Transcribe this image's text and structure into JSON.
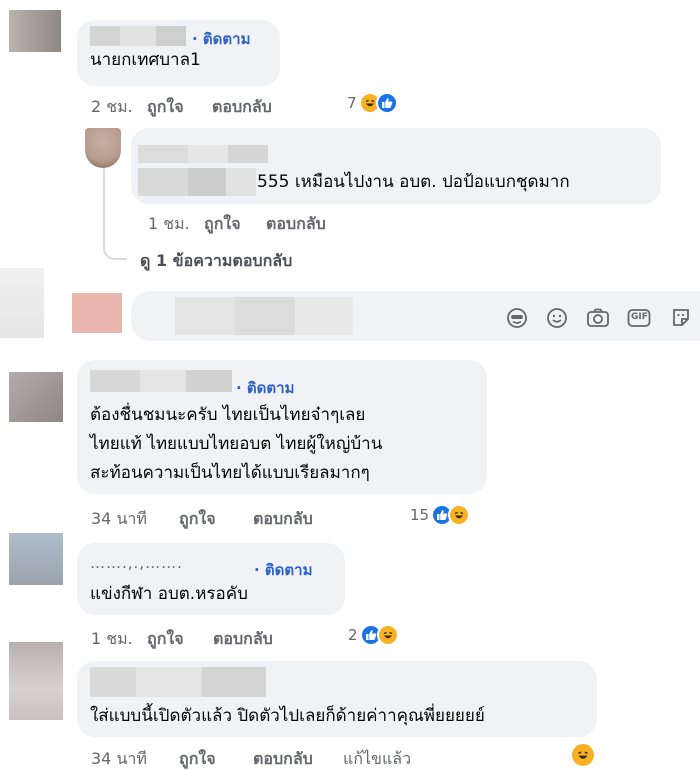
{
  "colors": {
    "bubble": "#f0f2f5",
    "follow": "#2d63c8",
    "meta": "#65676b",
    "like": "#1b74e4",
    "haha": "#f7b125"
  },
  "comments": [
    {
      "follow_label": "· ติดตาม",
      "text_lines": [
        "นายกเทศบาล1"
      ],
      "time": "2 ชม.",
      "like_label": "ถูกใจ",
      "reply_label": "ตอบกลับ",
      "reaction_count": "7",
      "reaction_icons": [
        "haha-icon",
        "like-icon"
      ]
    },
    {
      "text": "555 เหมือนไปงาน อบต. ปอป้อแบกชุดมาก",
      "time": "1 ชม.",
      "like_label": "ถูกใจ",
      "reply_label": "ตอบกลับ",
      "view_replies": "ดู 1 ข้อความตอบกลับ"
    },
    {
      "follow_label": "· ติดตาม",
      "text_lines": [
        "ต้องชื่นชมนะครับ ไทยเป็นไทยจ๋าๆเลย",
        "ไทยแท้ ไทยแบบไทยอบต ไทยผู้ใหญ่บ้าน",
        "สะท้อนความเป็นไทยได้แบบเรียลมากๆ"
      ],
      "time": "34 นาที",
      "like_label": "ถูกใจ",
      "reply_label": "ตอบกลับ",
      "reaction_count": "15",
      "reaction_icons": [
        "like-icon",
        "haha-icon"
      ]
    },
    {
      "name_partial": "…….,.,…….",
      "follow_label": "· ติดตาม",
      "text_lines": [
        "แข่งกีฬา อบต.หรอคับ"
      ],
      "time": "1 ชม.",
      "like_label": "ถูกใจ",
      "reply_label": "ตอบกลับ",
      "reaction_count": "2",
      "reaction_icons": [
        "like-icon",
        "haha-icon"
      ]
    },
    {
      "text_lines": [
        "ใส่แบบนี้เปิดตัวแล้ว ปิดตัวไปเลยก็ด้ายค่าาคุณพี่ยยยยย์"
      ],
      "time": "34 นาที",
      "like_label": "ถูกใจ",
      "reply_label": "ตอบกลับ",
      "edited_label": "แก้ไขแล้ว",
      "reaction_icons": [
        "haha-icon"
      ]
    }
  ],
  "composer": {
    "icons": [
      "sticker-face-icon",
      "emoji-icon",
      "camera-icon",
      "gif-icon",
      "sticker-icon"
    ],
    "gif_label": "GIF"
  }
}
